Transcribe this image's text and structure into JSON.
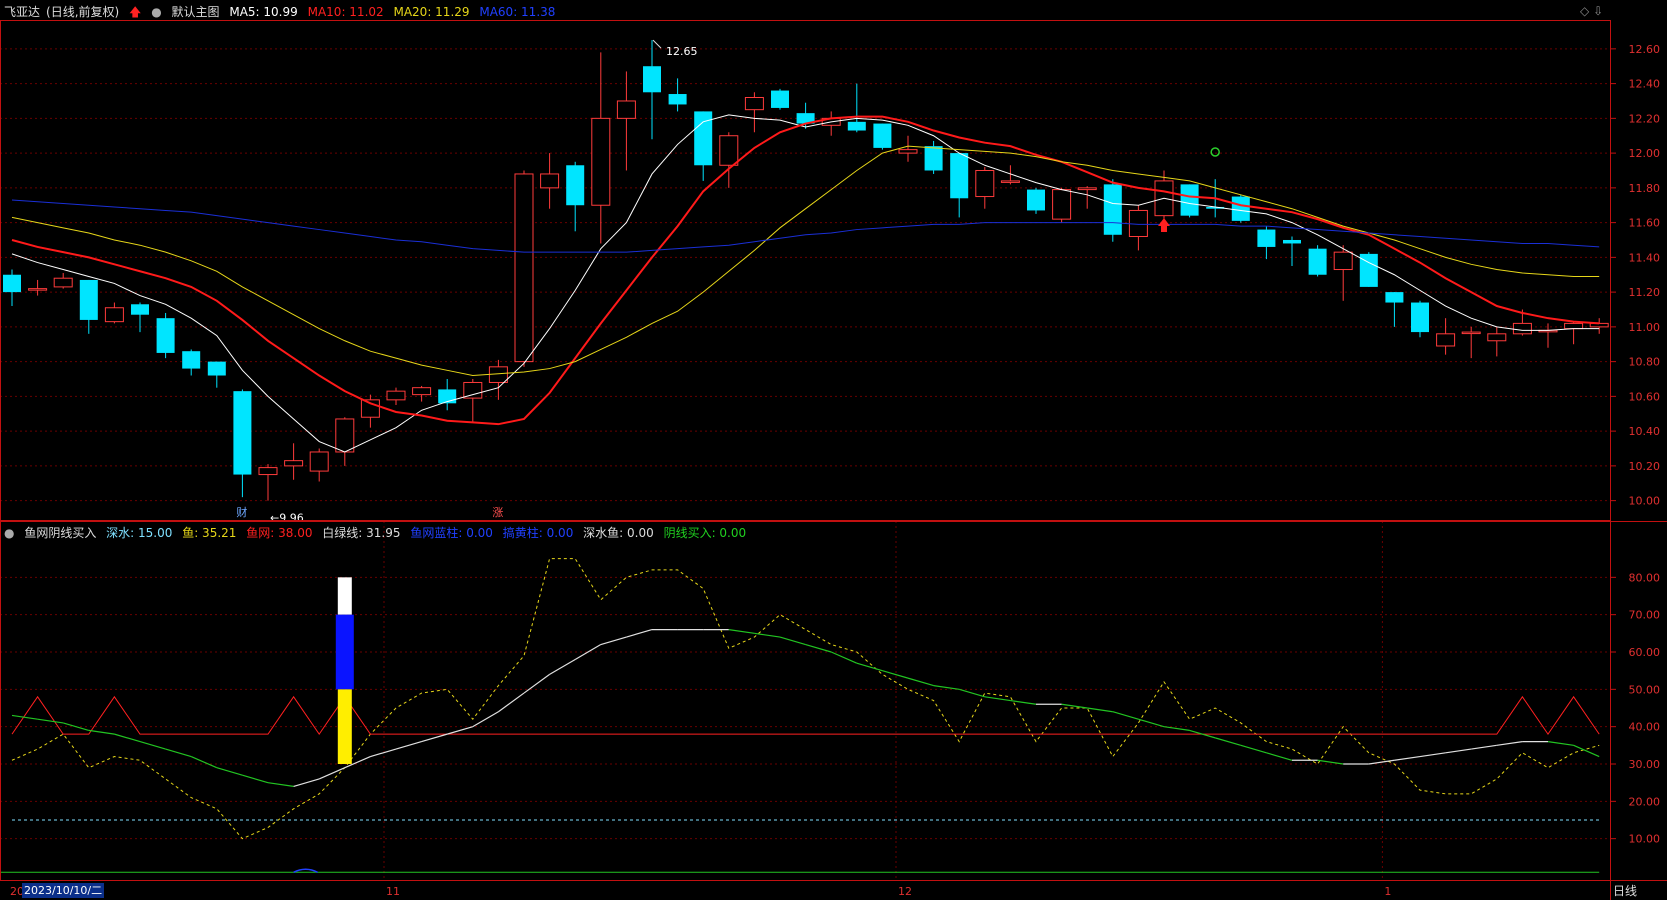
{
  "header": {
    "stock_name": "飞亚达",
    "adjust_mode": "(日线,前复权)",
    "main_chart_label": "默认主图",
    "ma5": "MA5: 10.99",
    "ma10": "MA10: 11.02",
    "ma20": "MA20: 11.29",
    "ma60": "MA60: 11.38"
  },
  "indicator_header": {
    "name": "鱼网阴线买入",
    "shenshui": "深水: 15.00",
    "yu": "鱼: 35.21",
    "yuwang": "鱼网: 38.00",
    "baixian": "白绿线: 31.95",
    "yuwang_lan": "鱼网蓝柱: 0.00",
    "huangzhu": "搞黄柱: 0.00",
    "shenshuiyu": "深水鱼: 0.00",
    "yinxian": "阴线买入: 0.00"
  },
  "annotations": {
    "high_label": "12.65",
    "low_label": "←9.96",
    "marker_cai": "财",
    "marker_zhang": "涨"
  },
  "xaxis": {
    "date_label": "2023/10/10/二",
    "month_labels": [
      "11",
      "12",
      "1"
    ],
    "left_marker": "20"
  },
  "period": "日线",
  "colors": {
    "up": "#ff3b3b",
    "down": "#00e5ff",
    "ma5": "#ffffff",
    "ma10": "#ff1a1a",
    "ma20": "#e6d619",
    "ma60": "#1a2fd6",
    "axis": "#c21010"
  },
  "chart_data": [
    {
      "type": "candlestick",
      "title": "飞亚达 (日线,前复权)",
      "ylim": [
        9.9,
        12.72
      ],
      "yticks": [
        10.0,
        10.2,
        10.4,
        10.6,
        10.8,
        11.0,
        11.2,
        11.4,
        11.6,
        11.8,
        12.0,
        12.2,
        12.4,
        12.6
      ],
      "candles": [
        {
          "o": 11.3,
          "h": 11.33,
          "l": 11.12,
          "c": 11.2
        },
        {
          "o": 11.22,
          "h": 11.27,
          "l": 11.18,
          "c": 11.22
        },
        {
          "o": 11.23,
          "h": 11.31,
          "l": 11.22,
          "c": 11.28
        },
        {
          "o": 11.27,
          "h": 11.27,
          "l": 10.96,
          "c": 11.04
        },
        {
          "o": 11.03,
          "h": 11.14,
          "l": 11.02,
          "c": 11.11
        },
        {
          "o": 11.13,
          "h": 11.14,
          "l": 10.97,
          "c": 11.07
        },
        {
          "o": 11.05,
          "h": 11.08,
          "l": 10.82,
          "c": 10.85
        },
        {
          "o": 10.86,
          "h": 10.87,
          "l": 10.72,
          "c": 10.76
        },
        {
          "o": 10.8,
          "h": 10.8,
          "l": 10.65,
          "c": 10.72
        },
        {
          "o": 10.63,
          "h": 10.64,
          "l": 10.02,
          "c": 10.15
        },
        {
          "o": 10.15,
          "h": 10.21,
          "l": 10.0,
          "c": 10.19
        },
        {
          "o": 10.2,
          "h": 10.33,
          "l": 10.12,
          "c": 10.23
        },
        {
          "o": 10.17,
          "h": 10.3,
          "l": 10.11,
          "c": 10.28
        },
        {
          "o": 10.28,
          "h": 10.48,
          "l": 10.2,
          "c": 10.47
        },
        {
          "o": 10.48,
          "h": 10.61,
          "l": 10.42,
          "c": 10.58
        },
        {
          "o": 10.58,
          "h": 10.65,
          "l": 10.55,
          "c": 10.63
        },
        {
          "o": 10.61,
          "h": 10.66,
          "l": 10.57,
          "c": 10.65
        },
        {
          "o": 10.64,
          "h": 10.7,
          "l": 10.52,
          "c": 10.56
        },
        {
          "o": 10.59,
          "h": 10.7,
          "l": 10.45,
          "c": 10.68
        },
        {
          "o": 10.68,
          "h": 10.81,
          "l": 10.58,
          "c": 10.77
        },
        {
          "o": 10.8,
          "h": 11.9,
          "l": 10.77,
          "c": 11.88
        },
        {
          "o": 11.8,
          "h": 12.0,
          "l": 11.68,
          "c": 11.88
        },
        {
          "o": 11.93,
          "h": 11.95,
          "l": 11.55,
          "c": 11.7
        },
        {
          "o": 11.7,
          "h": 12.58,
          "l": 11.48,
          "c": 12.2
        },
        {
          "o": 12.2,
          "h": 12.47,
          "l": 11.9,
          "c": 12.3
        },
        {
          "o": 12.5,
          "h": 12.65,
          "l": 12.08,
          "c": 12.35
        },
        {
          "o": 12.34,
          "h": 12.43,
          "l": 12.24,
          "c": 12.28
        },
        {
          "o": 12.24,
          "h": 12.24,
          "l": 11.84,
          "c": 11.93
        },
        {
          "o": 11.93,
          "h": 12.12,
          "l": 11.8,
          "c": 12.1
        },
        {
          "o": 12.25,
          "h": 12.35,
          "l": 12.12,
          "c": 12.32
        },
        {
          "o": 12.36,
          "h": 12.37,
          "l": 12.25,
          "c": 12.26
        },
        {
          "o": 12.23,
          "h": 12.29,
          "l": 12.14,
          "c": 12.17
        },
        {
          "o": 12.16,
          "h": 12.24,
          "l": 12.1,
          "c": 12.2
        },
        {
          "o": 12.18,
          "h": 12.4,
          "l": 12.12,
          "c": 12.13
        },
        {
          "o": 12.17,
          "h": 12.17,
          "l": 12.02,
          "c": 12.03
        },
        {
          "o": 12.0,
          "h": 12.1,
          "l": 11.95,
          "c": 12.02
        },
        {
          "o": 12.04,
          "h": 12.07,
          "l": 11.88,
          "c": 11.9
        },
        {
          "o": 12.0,
          "h": 12.0,
          "l": 11.63,
          "c": 11.74
        },
        {
          "o": 11.75,
          "h": 11.92,
          "l": 11.68,
          "c": 11.9
        },
        {
          "o": 11.84,
          "h": 11.93,
          "l": 11.82,
          "c": 11.84
        },
        {
          "o": 11.79,
          "h": 11.8,
          "l": 11.65,
          "c": 11.67
        },
        {
          "o": 11.62,
          "h": 11.8,
          "l": 11.6,
          "c": 11.79
        },
        {
          "o": 11.79,
          "h": 11.81,
          "l": 11.68,
          "c": 11.8
        },
        {
          "o": 11.82,
          "h": 11.85,
          "l": 11.49,
          "c": 11.53
        },
        {
          "o": 11.52,
          "h": 11.7,
          "l": 11.44,
          "c": 11.67
        },
        {
          "o": 11.64,
          "h": 11.9,
          "l": 11.6,
          "c": 11.84
        },
        {
          "o": 11.82,
          "h": 11.82,
          "l": 11.63,
          "c": 11.64
        },
        {
          "o": 11.69,
          "h": 11.85,
          "l": 11.63,
          "c": 11.68
        },
        {
          "o": 11.75,
          "h": 11.76,
          "l": 11.6,
          "c": 11.61
        },
        {
          "o": 11.56,
          "h": 11.58,
          "l": 11.39,
          "c": 11.46
        },
        {
          "o": 11.5,
          "h": 11.52,
          "l": 11.35,
          "c": 11.48
        },
        {
          "o": 11.45,
          "h": 11.47,
          "l": 11.29,
          "c": 11.3
        },
        {
          "o": 11.33,
          "h": 11.47,
          "l": 11.15,
          "c": 11.43
        },
        {
          "o": 11.42,
          "h": 11.43,
          "l": 11.23,
          "c": 11.23
        },
        {
          "o": 11.2,
          "h": 11.2,
          "l": 11.0,
          "c": 11.14
        },
        {
          "o": 11.14,
          "h": 11.15,
          "l": 10.94,
          "c": 10.97
        },
        {
          "o": 10.89,
          "h": 11.05,
          "l": 10.84,
          "c": 10.96
        },
        {
          "o": 10.97,
          "h": 11.0,
          "l": 10.82,
          "c": 10.97
        },
        {
          "o": 10.92,
          "h": 11.0,
          "l": 10.83,
          "c": 10.96
        },
        {
          "o": 10.96,
          "h": 11.1,
          "l": 10.95,
          "c": 11.02
        },
        {
          "o": 10.98,
          "h": 11.02,
          "l": 10.88,
          "c": 10.98
        },
        {
          "o": 10.99,
          "h": 11.03,
          "l": 10.9,
          "c": 11.02
        },
        {
          "o": 11.0,
          "h": 11.05,
          "l": 10.96,
          "c": 11.02
        }
      ],
      "series": [
        {
          "name": "MA5",
          "values": [
            11.42,
            11.37,
            11.33,
            11.29,
            11.25,
            11.18,
            11.13,
            11.05,
            10.95,
            10.75,
            10.6,
            10.47,
            10.34,
            10.28,
            10.35,
            10.42,
            10.52,
            10.57,
            10.61,
            10.65,
            10.79,
            10.99,
            11.21,
            11.45,
            11.6,
            11.88,
            12.05,
            12.18,
            12.22,
            12.2,
            12.19,
            12.15,
            12.18,
            12.2,
            12.19,
            12.16,
            12.1,
            12.0,
            11.93,
            11.88,
            11.83,
            11.79,
            11.76,
            11.71,
            11.7,
            11.74,
            11.71,
            11.69,
            11.67,
            11.65,
            11.6,
            11.53,
            11.45,
            11.37,
            11.3,
            11.21,
            11.12,
            11.05,
            11.0,
            10.98,
            10.98,
            10.99,
            10.99
          ]
        },
        {
          "name": "MA10",
          "values": [
            11.5,
            11.46,
            11.43,
            11.4,
            11.36,
            11.32,
            11.28,
            11.23,
            11.15,
            11.04,
            10.92,
            10.82,
            10.72,
            10.63,
            10.56,
            10.51,
            10.49,
            10.46,
            10.45,
            10.44,
            10.47,
            10.62,
            10.82,
            11.02,
            11.21,
            11.4,
            11.58,
            11.78,
            11.91,
            12.03,
            12.12,
            12.17,
            12.2,
            12.21,
            12.21,
            12.18,
            12.13,
            12.09,
            12.06,
            12.04,
            11.99,
            11.95,
            11.89,
            11.83,
            11.8,
            11.78,
            11.75,
            11.74,
            11.7,
            11.68,
            11.66,
            11.62,
            11.57,
            11.53,
            11.45,
            11.37,
            11.28,
            11.2,
            11.12,
            11.08,
            11.05,
            11.03,
            11.02
          ]
        },
        {
          "name": "MA20",
          "values": [
            11.63,
            11.6,
            11.57,
            11.54,
            11.5,
            11.47,
            11.43,
            11.38,
            11.32,
            11.23,
            11.15,
            11.07,
            10.99,
            10.92,
            10.86,
            10.82,
            10.78,
            10.75,
            10.72,
            10.73,
            10.74,
            10.76,
            10.8,
            10.87,
            10.94,
            11.02,
            11.09,
            11.2,
            11.32,
            11.44,
            11.57,
            11.68,
            11.79,
            11.9,
            12.0,
            12.04,
            12.03,
            12.02,
            12.01,
            12.0,
            11.98,
            11.95,
            11.93,
            11.9,
            11.88,
            11.86,
            11.84,
            11.8,
            11.76,
            11.72,
            11.68,
            11.63,
            11.58,
            11.54,
            11.5,
            11.45,
            11.4,
            11.36,
            11.33,
            11.31,
            11.3,
            11.29,
            11.29
          ]
        },
        {
          "name": "MA60",
          "values": [
            11.73,
            11.72,
            11.71,
            11.7,
            11.69,
            11.68,
            11.67,
            11.66,
            11.64,
            11.62,
            11.6,
            11.58,
            11.56,
            11.54,
            11.52,
            11.5,
            11.49,
            11.47,
            11.45,
            11.44,
            11.43,
            11.43,
            11.43,
            11.43,
            11.43,
            11.44,
            11.45,
            11.46,
            11.47,
            11.49,
            11.51,
            11.53,
            11.54,
            11.56,
            11.57,
            11.58,
            11.59,
            11.59,
            11.6,
            11.6,
            11.6,
            11.6,
            11.6,
            11.6,
            11.59,
            11.59,
            11.59,
            11.59,
            11.58,
            11.58,
            11.57,
            11.56,
            11.55,
            11.54,
            11.53,
            11.52,
            11.51,
            11.5,
            11.49,
            11.48,
            11.48,
            11.47,
            11.46
          ]
        }
      ]
    },
    {
      "type": "line",
      "title": "鱼网阴线买入",
      "ylim": [
        0,
        90
      ],
      "yticks": [
        10.0,
        20.0,
        30.0,
        40.0,
        50.0,
        60.0,
        70.0,
        80.0
      ],
      "series": [
        {
          "name": "深水",
          "values": [
            15,
            15,
            15,
            15,
            15,
            15,
            15,
            15,
            15,
            15,
            15,
            15,
            15,
            15,
            15,
            15,
            15,
            15,
            15,
            15,
            15,
            15,
            15,
            15,
            15,
            15,
            15,
            15,
            15,
            15,
            15,
            15,
            15,
            15,
            15,
            15,
            15,
            15,
            15,
            15,
            15,
            15,
            15,
            15,
            15,
            15,
            15,
            15,
            15,
            15,
            15,
            15,
            15,
            15,
            15,
            15,
            15,
            15,
            15,
            15,
            15,
            15,
            15
          ]
        },
        {
          "name": "鱼",
          "values": [
            31,
            34,
            38,
            29,
            32,
            31,
            26,
            21,
            18,
            10,
            13,
            18,
            22,
            29,
            38,
            45,
            49,
            50,
            42,
            51,
            59,
            85,
            85,
            74,
            80,
            82,
            82,
            77,
            61,
            64,
            70,
            66,
            62,
            60,
            54,
            50,
            47,
            36,
            49,
            48,
            36,
            45,
            45,
            32,
            41,
            52,
            42,
            45,
            41,
            36,
            34,
            30,
            40,
            33,
            30,
            23,
            22,
            22,
            26,
            33,
            29,
            33,
            35
          ]
        },
        {
          "name": "鱼网",
          "values": [
            38,
            48,
            38,
            38,
            48,
            38,
            38,
            38,
            38,
            38,
            38,
            48,
            38,
            48,
            38,
            38,
            38,
            38,
            38,
            38,
            38,
            38,
            38,
            38,
            38,
            38,
            38,
            38,
            38,
            38,
            38,
            38,
            38,
            38,
            38,
            38,
            38,
            38,
            38,
            38,
            38,
            38,
            38,
            38,
            38,
            38,
            38,
            38,
            38,
            38,
            38,
            38,
            38,
            38,
            38,
            38,
            38,
            38,
            38,
            48,
            38,
            48,
            38
          ]
        },
        {
          "name": "白绿线",
          "values": [
            43,
            42,
            41,
            39,
            38,
            36,
            34,
            32,
            29,
            27,
            25,
            24,
            26,
            29,
            32,
            34,
            36,
            38,
            40,
            44,
            49,
            54,
            58,
            62,
            64,
            66,
            66,
            66,
            66,
            65,
            64,
            62,
            60,
            57,
            55,
            53,
            51,
            50,
            48,
            47,
            46,
            46,
            45,
            44,
            42,
            40,
            39,
            37,
            35,
            33,
            31,
            31,
            30,
            30,
            31,
            32,
            33,
            34,
            35,
            36,
            36,
            35,
            32
          ]
        }
      ],
      "bars": [
        {
          "index": 13,
          "white": [
            80,
            70
          ],
          "blue": [
            70,
            50
          ],
          "yellow": [
            50,
            30
          ]
        }
      ]
    }
  ]
}
